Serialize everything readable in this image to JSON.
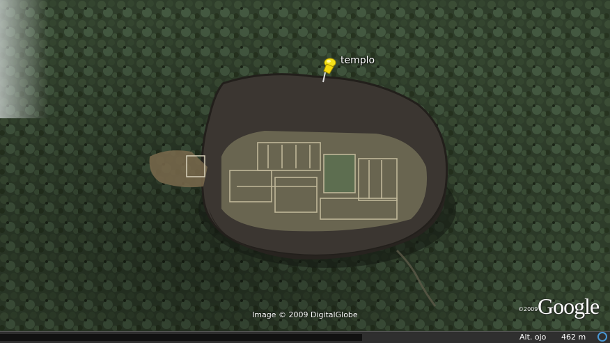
{
  "placemark": {
    "label": "templo",
    "icon": "yellow-pushpin-icon"
  },
  "attribution": {
    "imagery_credit": "Image © 2009 DigitalGlobe",
    "google_copyright": "©2009",
    "google_logo": "Google"
  },
  "status_bar": {
    "eye_alt_label": "Alt. ojo",
    "eye_alt_value": "462 m",
    "stream_icon": "streaming-status-icon"
  },
  "colors": {
    "forest": "#2e3d2a",
    "rock": "#3a3530",
    "ruins": "#6e6a52",
    "pin": "#f5e21a"
  }
}
